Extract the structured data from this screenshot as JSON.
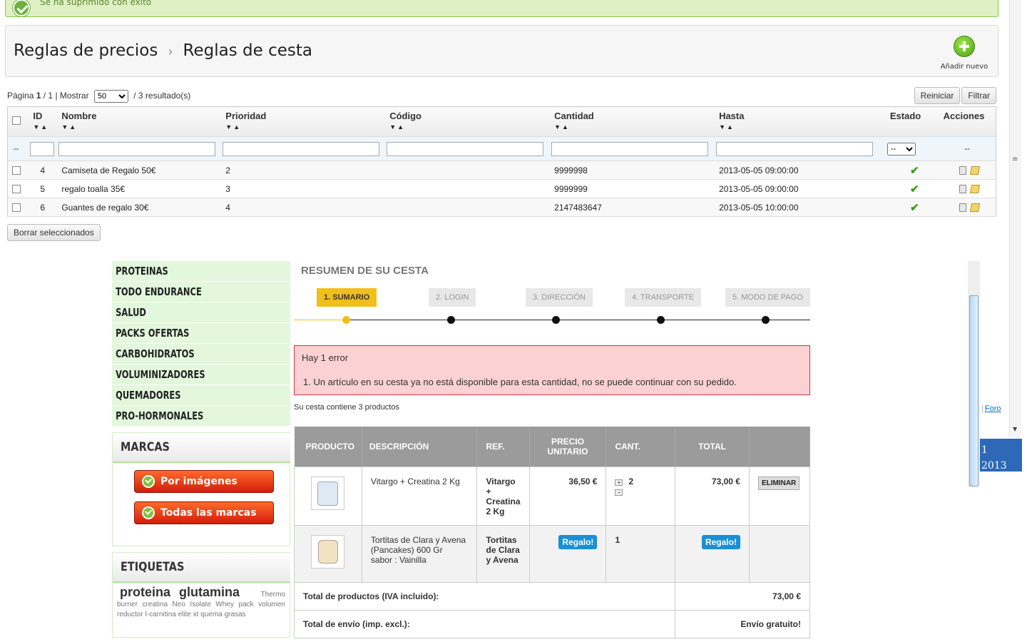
{
  "success_message": "Se ha suprimido con éxito",
  "breadcrumb": {
    "parent": "Reglas de precios",
    "current": "Reglas de cesta"
  },
  "add_new_label": "Añadir nuevo",
  "pager": {
    "page_label": "Página",
    "page": "1",
    "total_pages": "/ 1",
    "show_label": "| Mostrar",
    "per_page": "50",
    "results": "/ 3 resultado(s)"
  },
  "buttons": {
    "reset": "Reiniciar",
    "filter": "Filtrar",
    "delete_selected": "Borrar seleccionados"
  },
  "admin_table": {
    "headers": [
      "ID",
      "Nombre",
      "Prioridad",
      "Código",
      "Cantidad",
      "Hasta",
      "Estado",
      "Acciones"
    ],
    "filter_placeholder": "--",
    "rows": [
      {
        "id": "4",
        "name": "Camiseta de Regalo 50€",
        "priority": "2",
        "code": "",
        "quantity": "9999998",
        "until": "2013-05-05 09:00:00"
      },
      {
        "id": "5",
        "name": "regalo toalla 35€",
        "priority": "3",
        "code": "",
        "quantity": "9999999",
        "until": "2013-05-05 09:00:00"
      },
      {
        "id": "6",
        "name": "Guantes de regalo 30€",
        "priority": "4",
        "code": "",
        "quantity": "2147483647",
        "until": "2013-05-05 10:00:00"
      }
    ]
  },
  "shop": {
    "categories": [
      "PROTEINAS",
      "TODO ENDURANCE",
      "SALUD",
      "PACKS OFERTAS",
      "CARBOHIDRATOS",
      "VOLUMINIZADORES",
      "QUEMADORES",
      "PRO-HORMONALES"
    ],
    "marcas_title": "MARCAS",
    "marcas_buttons": [
      "Por imágenes",
      "Todas las marcas"
    ],
    "etiquetas_title": "ETIQUETAS",
    "tags_big": [
      "proteina",
      "glutamina"
    ],
    "tags_small": "Thermo burner creatina Neo Isolate Whey pack volumen reductor l-carnitina elite xt quema grasas",
    "summary_title": "RESUMEN DE SU CESTA",
    "steps": [
      "1. SUMARIO",
      "2. LOGIN",
      "3. DIRECCIÓN",
      "4. TRANSPORTE",
      "5. MODO DE PAGO"
    ],
    "error_title": "Hay 1 error",
    "error_item": "1.  Un artículo en su cesta ya no está disponible para esta cantidad, no se puede continuar con su pedido.",
    "cart_count": "Su cesta contiene 3 productos",
    "cart_headers": [
      "PRODUCTO",
      "DESCRIPCIÓN",
      "REF.",
      "PRECIO UNITARIO",
      "CANT.",
      "TOTAL"
    ],
    "items": [
      {
        "desc": "Vitargo + Creatina 2 Kg",
        "ref": "Vitargo + Creatina 2 Kg",
        "price": "36,50 €",
        "qty": "2",
        "total": "73,00 €",
        "action": "ELIMINAR"
      },
      {
        "desc": "Tortitas de Clara y Avena (Pancakes) 600 Gr",
        "attr": "sabor : Vainilla",
        "ref": "Tortitas de Clara y Avena",
        "price": "Regalo!",
        "qty": "1",
        "total": "Regalo!"
      }
    ],
    "totals": [
      {
        "label": "Total de productos (IVA incluido):",
        "value": "73,00 €"
      },
      {
        "label": "Total de envío (imp. excl.):",
        "value": "Envío gratuito!"
      }
    ]
  },
  "side_fragments": {
    "foro": "Foro",
    "box_line1": "1",
    "box_line2": "2013"
  }
}
